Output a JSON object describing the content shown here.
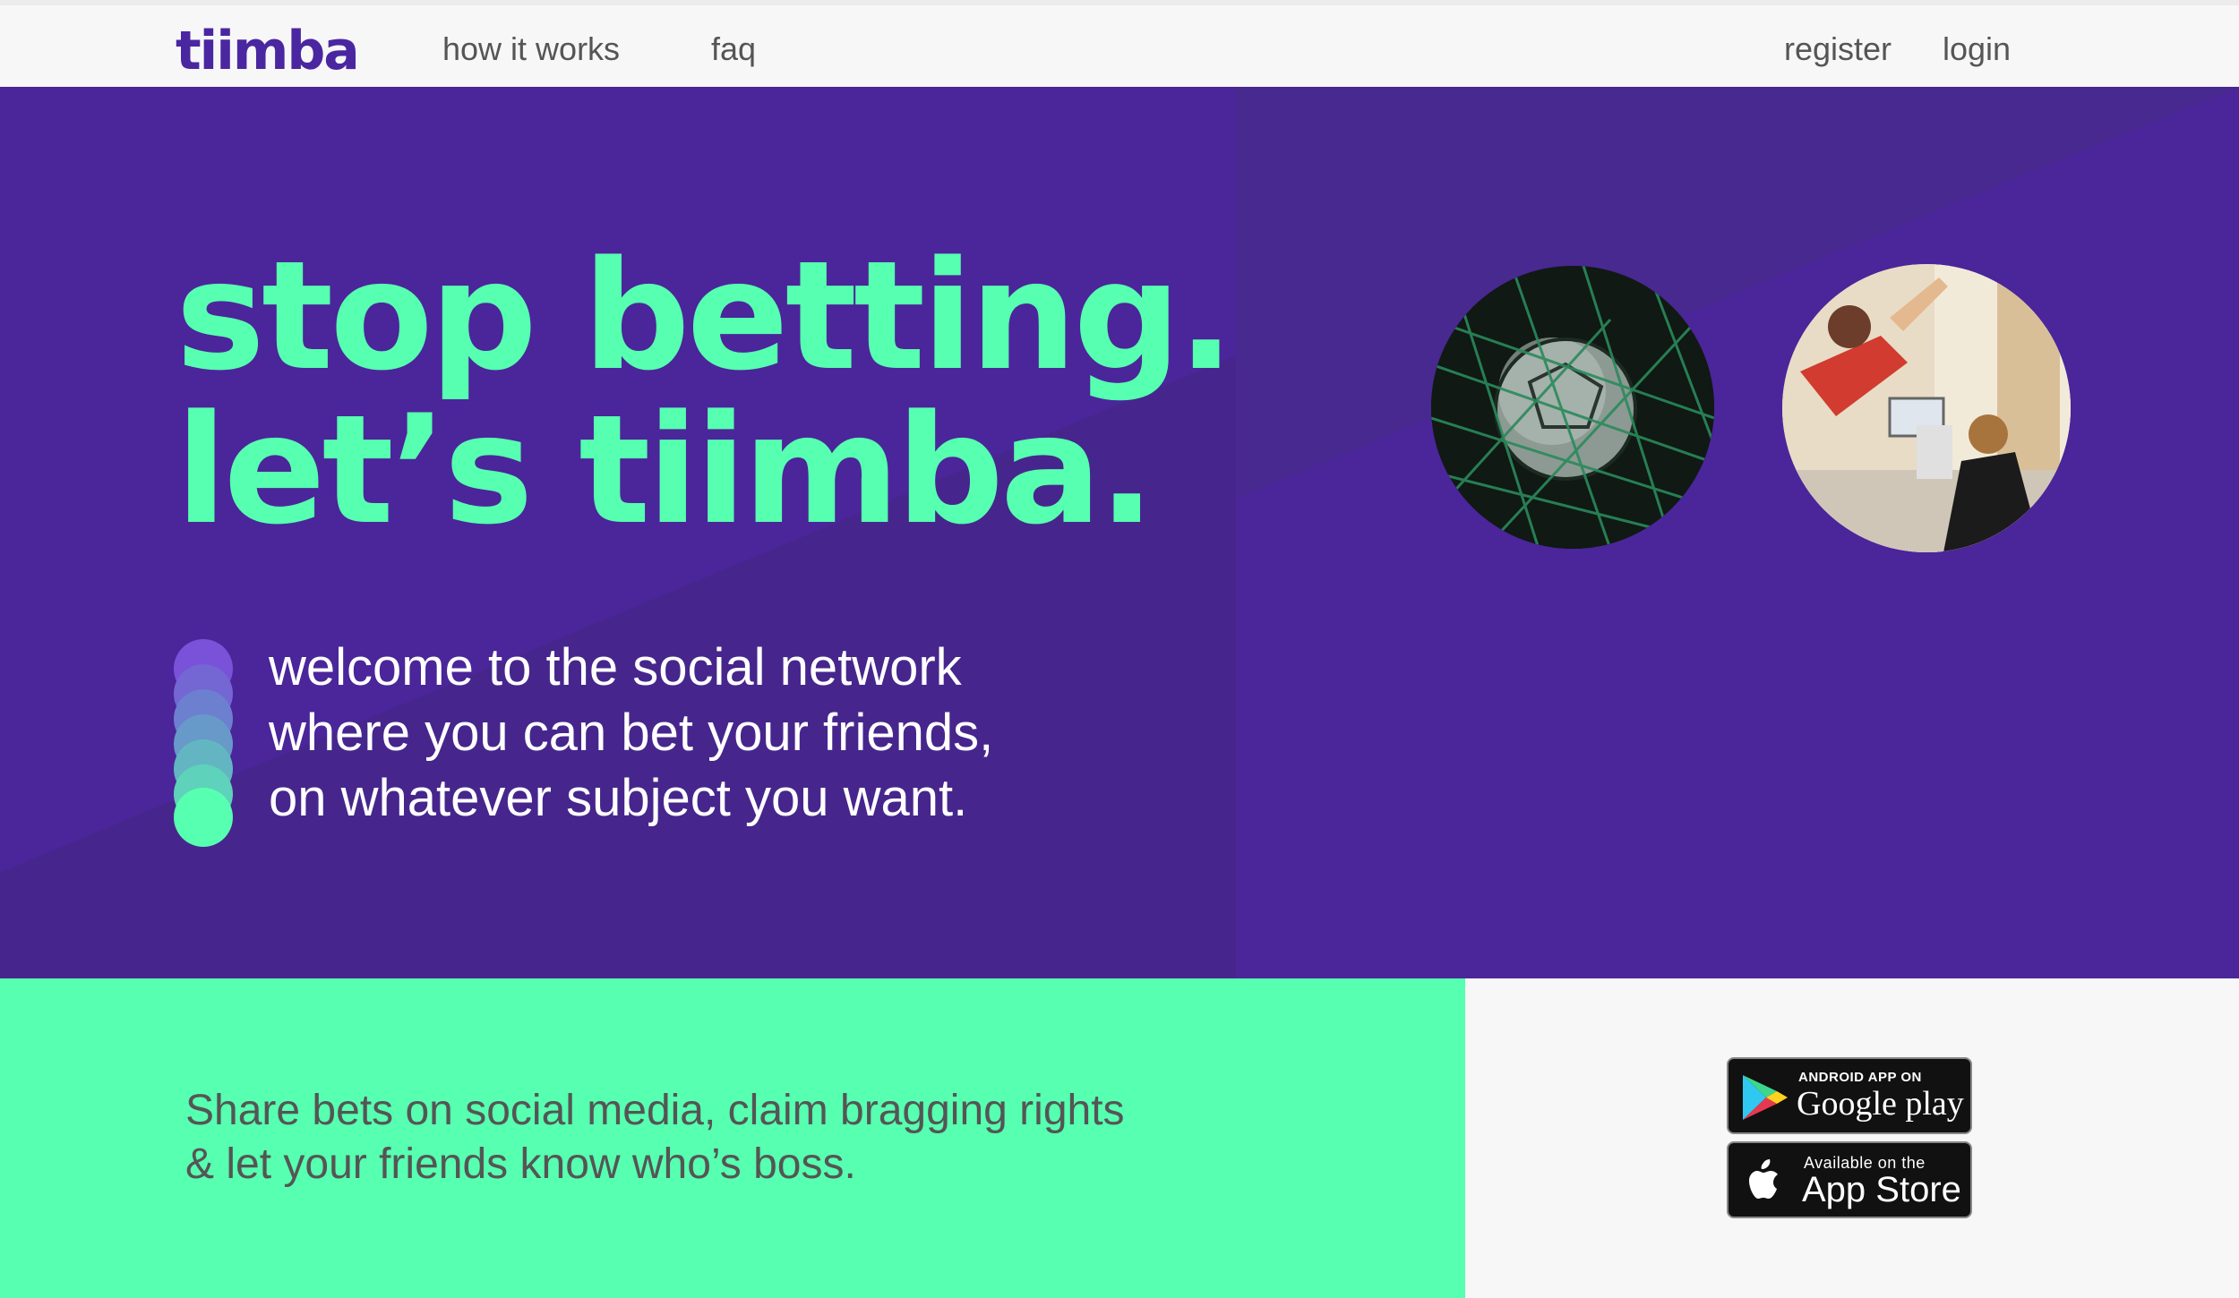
{
  "nav": {
    "logo": "tiimba",
    "links": {
      "how_it_works": "how it works",
      "faq": "faq",
      "register": "register",
      "login": "login"
    }
  },
  "hero": {
    "headline": [
      "stop betting.",
      "let’s tiimba."
    ],
    "subline": [
      "welcome to the social network",
      "where you can bet your friends,",
      "on whatever subject you want."
    ]
  },
  "footer": {
    "tagline": [
      "Share bets on social media, claim bragging rights",
      "& let your friends know who’s boss."
    ],
    "google_play": {
      "small": "ANDROID APP ON",
      "big": "Google play"
    },
    "app_store": {
      "small": "Available on the",
      "big": "App Store"
    }
  },
  "colors": {
    "brand_purple": "#4b259a",
    "brand_mint": "#57ffb0",
    "text_gray": "#555555"
  },
  "icons": [
    "google-play-icon",
    "apple-icon"
  ]
}
